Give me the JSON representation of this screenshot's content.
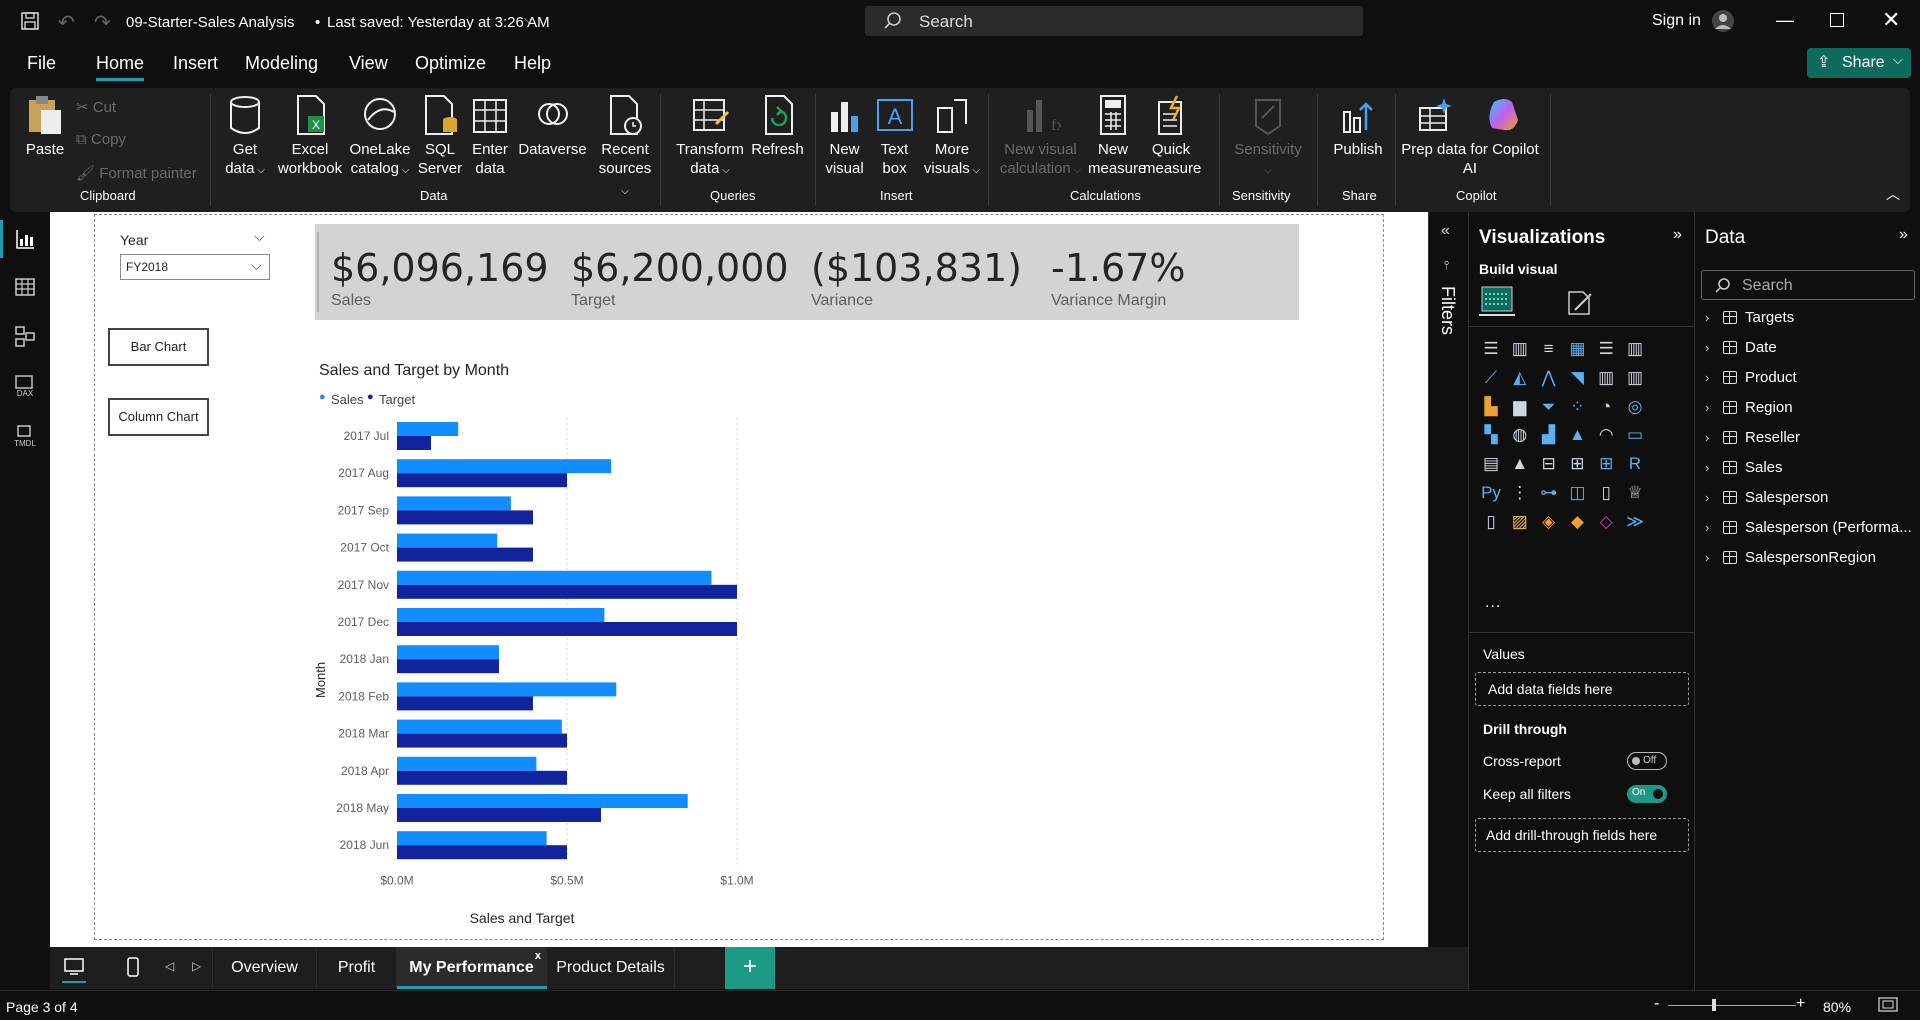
{
  "titlebar": {
    "file_title": "09-Starter-Sales Analysis",
    "saved_status": "Last saved: Yesterday at 3:26 AM",
    "search_placeholder": "Search",
    "sign_in": "Sign in"
  },
  "menu": {
    "items": [
      "File",
      "Home",
      "Insert",
      "Modeling",
      "View",
      "Optimize",
      "Help"
    ],
    "active": "Home",
    "share_label": "Share"
  },
  "ribbon": {
    "clipboard": {
      "paste": "Paste",
      "cut": "Cut",
      "copy": "Copy",
      "format_painter": "Format painter",
      "group": "Clipboard"
    },
    "data": {
      "get_data": [
        "Get",
        "data"
      ],
      "excel": [
        "Excel",
        "workbook"
      ],
      "onelake": [
        "OneLake",
        "catalog"
      ],
      "sql": [
        "SQL",
        "Server"
      ],
      "enter": [
        "Enter",
        "data"
      ],
      "dataverse": "Dataverse",
      "recent": [
        "Recent",
        "sources"
      ],
      "group": "Data"
    },
    "queries": {
      "transform": [
        "Transform",
        "data"
      ],
      "refresh": "Refresh",
      "group": "Queries"
    },
    "insert": {
      "new_visual": [
        "New",
        "visual"
      ],
      "text_box": [
        "Text",
        "box"
      ],
      "more_visuals": [
        "More",
        "visuals"
      ],
      "group": "Insert"
    },
    "calculations": {
      "new_visual_calc": [
        "New visual",
        "calculation"
      ],
      "new_measure": [
        "New",
        "measure"
      ],
      "quick_measure": [
        "Quick",
        "measure"
      ],
      "group": "Calculations"
    },
    "sensitivity": {
      "label": "Sensitivity",
      "group": "Sensitivity"
    },
    "share": {
      "publish": "Publish",
      "group": "Share"
    },
    "copilot": {
      "prep": [
        "Prep data for Copilot",
        "AI"
      ],
      "group": "Copilot"
    }
  },
  "canvas": {
    "slicer": {
      "title": "Year",
      "value": "FY2018"
    },
    "buttons": {
      "bar": "Bar Chart",
      "column": "Column Chart"
    },
    "kpis": [
      {
        "value": "$6,096,169",
        "label": "Sales"
      },
      {
        "value": "$6,200,000",
        "label": "Target"
      },
      {
        "value": "($103,831)",
        "label": "Variance"
      },
      {
        "value": "-1.67%",
        "label": "Variance Margin"
      }
    ]
  },
  "chart_data": {
    "type": "bar",
    "orientation": "horizontal",
    "title": "Sales and Target by Month",
    "xlabel": "Sales and Target",
    "ylabel": "Month",
    "xlim": [
      0,
      1000000
    ],
    "x_ticks": [
      "$0.0M",
      "$0.5M",
      "$1.0M"
    ],
    "legend_position": "top-left",
    "categories": [
      "2017 Jul",
      "2017 Aug",
      "2017 Sep",
      "2017 Oct",
      "2017 Nov",
      "2017 Dec",
      "2018 Jan",
      "2018 Feb",
      "2018 Mar",
      "2018 Apr",
      "2018 May",
      "2018 Jun"
    ],
    "series": [
      {
        "name": "Sales",
        "color": "#118dff",
        "values": [
          180000,
          630000,
          335000,
          295000,
          925000,
          610000,
          300000,
          645000,
          485000,
          410000,
          855000,
          440000
        ]
      },
      {
        "name": "Target",
        "color": "#12239e",
        "values": [
          100000,
          500000,
          400000,
          400000,
          1000000,
          1000000,
          300000,
          400000,
          500000,
          500000,
          600000,
          500000
        ]
      }
    ]
  },
  "filters": {
    "label": "Filters"
  },
  "visualizations": {
    "title": "Visualizations",
    "build_visual": "Build visual",
    "values_label": "Values",
    "values_placeholder": "Add data fields here",
    "drill_through": "Drill through",
    "cross_report": "Cross-report",
    "cross_report_state": "Off",
    "keep_filters": "Keep all filters",
    "keep_filters_state": "On",
    "drill_placeholder": "Add drill-through fields here",
    "more": "..."
  },
  "data_pane": {
    "title": "Data",
    "search_placeholder": "Search",
    "tables": [
      "Targets",
      "Date",
      "Product",
      "Region",
      "Reseller",
      "Sales",
      "Salesperson",
      "Salesperson (Performa...",
      "SalespersonRegion"
    ]
  },
  "tabs": {
    "pages": [
      "Overview",
      "Profit",
      "My Performance",
      "Product Details"
    ],
    "active": "My Performance",
    "add": "+"
  },
  "status": {
    "page": "Page 3 of 4",
    "zoom": "80%"
  }
}
